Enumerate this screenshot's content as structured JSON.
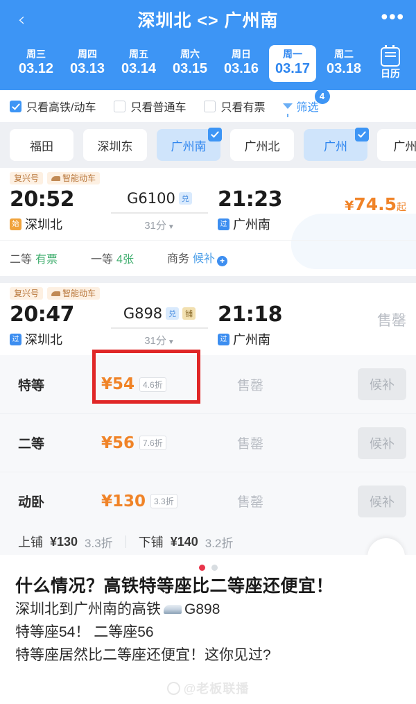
{
  "header": {
    "back_icon": "chevron-left-icon",
    "title": "深圳北 <> 广州南",
    "more_icon": "more-horizontal-icon",
    "calendar_label": "日历",
    "dates": [
      {
        "weekday": "周三",
        "date": "03.12",
        "selected": false
      },
      {
        "weekday": "周四",
        "date": "03.13",
        "selected": false
      },
      {
        "weekday": "周五",
        "date": "03.14",
        "selected": false
      },
      {
        "weekday": "周六",
        "date": "03.15",
        "selected": false
      },
      {
        "weekday": "周日",
        "date": "03.16",
        "selected": false
      },
      {
        "weekday": "周一",
        "date": "03.17",
        "selected": true
      },
      {
        "weekday": "周二",
        "date": "03.18",
        "selected": false
      }
    ]
  },
  "filters": {
    "checkboxes": [
      {
        "label": "只看高铁/动车",
        "checked": true
      },
      {
        "label": "只看普通车",
        "checked": false
      },
      {
        "label": "只看有票",
        "checked": false
      }
    ],
    "sort_label": "筛选",
    "sort_badge": "4"
  },
  "station_chips": [
    {
      "label": "福田",
      "selected": false
    },
    {
      "label": "深圳东",
      "selected": false
    },
    {
      "label": "广州南",
      "selected": true
    },
    {
      "label": "广州北",
      "selected": false
    },
    {
      "label": "广州",
      "selected": true
    },
    {
      "label": "广州E",
      "selected": false
    }
  ],
  "trains": [
    {
      "tags": [
        "复兴号",
        "智能动车"
      ],
      "depart_time": "20:52",
      "depart_station": "深圳北",
      "depart_badge": "始",
      "train_no": "G6100",
      "train_tags": [
        {
          "text": "兑",
          "style": "blue"
        }
      ],
      "duration": "31分",
      "arrive_time": "21:23",
      "arrive_station": "广州南",
      "arrive_badge": "过",
      "price": "74.5",
      "price_prefix": "¥",
      "price_suffix": "起",
      "seats": [
        {
          "name": "二等",
          "value": "有票",
          "kind": "green"
        },
        {
          "name": "一等",
          "value": "4张",
          "kind": "green"
        },
        {
          "name": "商务",
          "value": "候补",
          "kind": "blue",
          "plus": true
        }
      ]
    },
    {
      "tags": [
        "复兴号",
        "智能动车"
      ],
      "depart_time": "20:47",
      "depart_station": "深圳北",
      "depart_badge": "过",
      "train_no": "G898",
      "train_tags": [
        {
          "text": "兑",
          "style": "blue"
        },
        {
          "text": "铺",
          "style": "gold"
        }
      ],
      "duration": "31分",
      "arrive_time": "21:18",
      "arrive_station": "广州南",
      "arrive_badge": "过",
      "status_right": "售罄",
      "seat_rows": [
        {
          "name": "特等",
          "price": "¥54",
          "discount": "4.6折",
          "status": "售罄",
          "button": "候补",
          "highlight": true
        },
        {
          "name": "二等",
          "price": "¥56",
          "discount": "7.6折",
          "status": "售罄",
          "button": "候补",
          "highlight": false
        },
        {
          "name": "动卧",
          "price": "¥130",
          "discount": "3.3折",
          "status": "售罄",
          "button": "候补",
          "highlight": false
        }
      ],
      "berths": [
        {
          "label": "上铺",
          "price": "¥130",
          "discount": "3.3折"
        },
        {
          "label": "下铺",
          "price": "¥140",
          "discount": "3.2折"
        }
      ],
      "collapse_icon": "collapse-minus-icon"
    }
  ],
  "caption": {
    "dots": [
      true,
      false
    ],
    "title": "什么情况？高铁特等座比二等座还便宜！",
    "lines": [
      {
        "before": "深圳北到广州南的高铁",
        "icon": "train-icon",
        "after": "G898"
      },
      {
        "before": "特等座54！ 二等座56",
        "icon": "",
        "after": ""
      },
      {
        "before": "特等座居然比二等座还便宜！这你见过?",
        "icon": "",
        "after": ""
      }
    ],
    "watermark": "@老板联播"
  }
}
